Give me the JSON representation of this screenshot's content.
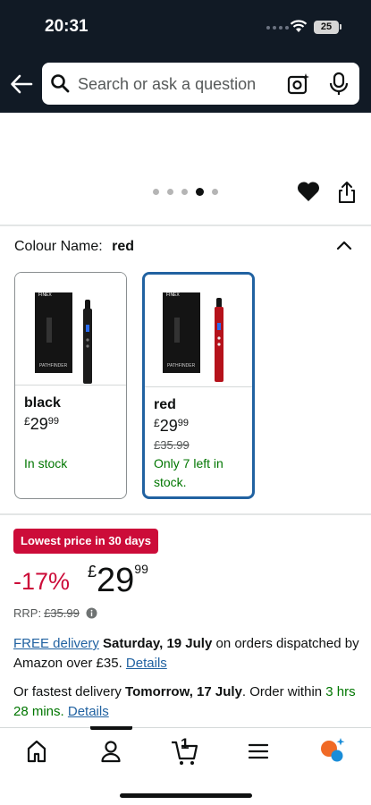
{
  "status_bar": {
    "time": "20:31",
    "battery": "25"
  },
  "search": {
    "placeholder": "Search or ask a question"
  },
  "carousel": {
    "dot_count": 5,
    "active_index": 3
  },
  "colour": {
    "label": "Colour Name:",
    "selected": "red",
    "options": [
      {
        "name": "black",
        "currency": "£",
        "whole": "29",
        "fraction": "99",
        "was": "",
        "stock": "In stock",
        "brand": "FINEX",
        "model": "PATHFINDER",
        "device_color": "#1b1b1b"
      },
      {
        "name": "red",
        "currency": "£",
        "whole": "29",
        "fraction": "99",
        "was": "£35.99",
        "stock": "Only 7 left in stock.",
        "brand": "FINEX",
        "model": "PATHFINDER",
        "device_color": "#b5121b"
      }
    ]
  },
  "deal": {
    "badge": "Lowest price in 30 days"
  },
  "price": {
    "discount": "-17%",
    "currency": "£",
    "whole": "29",
    "fraction": "99"
  },
  "rrp": {
    "label": "RRP:",
    "value": "£35.99"
  },
  "delivery": {
    "free_link": "FREE delivery",
    "free_date": "Saturday, 19 July",
    "free_rest": "on orders dispatched by Amazon over £35.",
    "details1": "Details",
    "fast_prefix": "Or fastest delivery",
    "fast_date": "Tomorrow, 17 July",
    "fast_rest": ". Order within",
    "fast_time": "3 hrs 28 mins.",
    "details2": "Details"
  },
  "nav": {
    "cart_count": "1"
  },
  "icons": [
    "back-arrow-icon",
    "search-icon",
    "camera-lens-icon",
    "microphone-icon",
    "heart-icon",
    "share-icon",
    "chevron-up-icon",
    "info-icon",
    "home-icon",
    "account-icon",
    "cart-icon",
    "menu-icon",
    "rufus-chat-icon"
  ]
}
